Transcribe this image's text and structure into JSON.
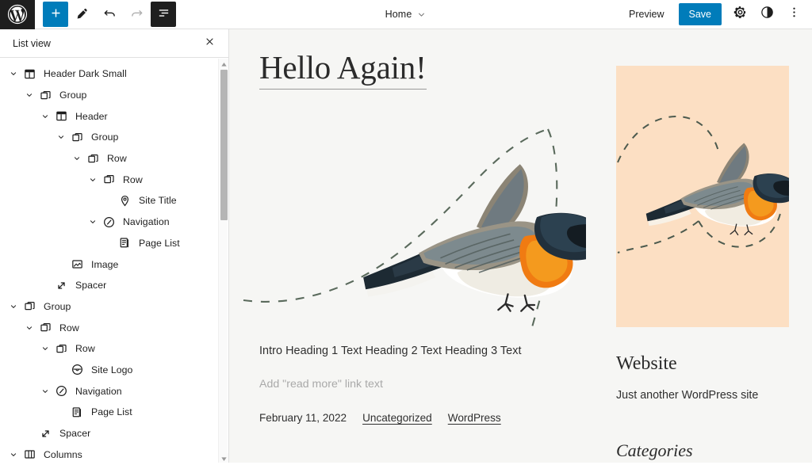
{
  "topbar": {
    "logo_icon": "wordpress-logo-icon",
    "tools": [
      {
        "name": "add-block-button",
        "icon": "plus-icon",
        "label": "Add block",
        "style": "primary"
      },
      {
        "name": "edit-tool-button",
        "icon": "pencil-icon",
        "label": "Tools",
        "style": "plain"
      },
      {
        "name": "undo-button",
        "icon": "undo-icon",
        "label": "Undo",
        "style": "plain"
      },
      {
        "name": "redo-button",
        "icon": "redo-icon",
        "label": "Redo",
        "style": "disabled"
      },
      {
        "name": "list-view-button",
        "icon": "list-view-icon",
        "label": "List View",
        "style": "dark"
      }
    ],
    "document_title": "Home",
    "chevron_icon": "chevron-down-icon",
    "preview_label": "Preview",
    "save_label": "Save",
    "settings_icon": "gear-icon",
    "styles_icon": "contrast-half-circle-icon",
    "more_icon": "kebab-vertical-icon",
    "accent_color": "#007cba",
    "logo_bg_color": "#1e1e1e"
  },
  "sidebar": {
    "title": "List view",
    "close_icon": "close-icon",
    "scroll_up_icon": "triangle-up-icon",
    "scroll_down_icon": "triangle-down-icon",
    "tree": [
      {
        "label": "Header Dark Small",
        "icon": "template-part-icon",
        "depth": 0,
        "expanded": true
      },
      {
        "label": "Group",
        "icon": "group-icon",
        "depth": 1,
        "expanded": true
      },
      {
        "label": "Header",
        "icon": "template-part-icon",
        "depth": 2,
        "expanded": true
      },
      {
        "label": "Group",
        "icon": "group-icon",
        "depth": 3,
        "expanded": true
      },
      {
        "label": "Row",
        "icon": "group-icon",
        "depth": 4,
        "expanded": true
      },
      {
        "label": "Row",
        "icon": "group-icon",
        "depth": 5,
        "expanded": true
      },
      {
        "label": "Site Title",
        "icon": "map-marker-icon",
        "depth": 6,
        "expanded": null
      },
      {
        "label": "Navigation",
        "icon": "navigation-icon",
        "depth": 5,
        "expanded": true
      },
      {
        "label": "Page List",
        "icon": "page-list-icon",
        "depth": 6,
        "expanded": null
      },
      {
        "label": "Image",
        "icon": "image-icon",
        "depth": 3,
        "expanded": null
      },
      {
        "label": "Spacer",
        "icon": "spacer-icon",
        "depth": 2,
        "expanded": null
      },
      {
        "label": "Group",
        "icon": "group-icon",
        "depth": 0,
        "expanded": true
      },
      {
        "label": "Row",
        "icon": "group-icon",
        "depth": 1,
        "expanded": true
      },
      {
        "label": "Row",
        "icon": "group-icon",
        "depth": 2,
        "expanded": true
      },
      {
        "label": "Site Logo",
        "icon": "site-logo-icon",
        "depth": 3,
        "expanded": null
      },
      {
        "label": "Navigation",
        "icon": "navigation-icon",
        "depth": 2,
        "expanded": true
      },
      {
        "label": "Page List",
        "icon": "page-list-icon",
        "depth": 3,
        "expanded": null
      },
      {
        "label": "Spacer",
        "icon": "spacer-icon",
        "depth": 1,
        "expanded": null
      },
      {
        "label": "Columns",
        "icon": "columns-icon",
        "depth": 0,
        "expanded": true
      }
    ]
  },
  "canvas": {
    "background_color": "#f6f6f4",
    "post": {
      "title": "Hello Again!",
      "featured_image_alt": "illustration of a flying swallow with orange throat and dashed flight path",
      "excerpt": "Intro Heading 1 Text Heading 2 Text Heading 3 Text",
      "read_more_placeholder": "Add \"read more\" link text",
      "date": "February 11, 2022",
      "category": "Uncategorized",
      "tag": "WordPress"
    },
    "sidebar_widgets": {
      "card_color": "#fcdfc3",
      "card_image_alt": "flying swallow on peach background with dashed flight path",
      "site_title": "Website",
      "site_tagline": "Just another WordPress site",
      "categories_heading": "Categories"
    }
  }
}
